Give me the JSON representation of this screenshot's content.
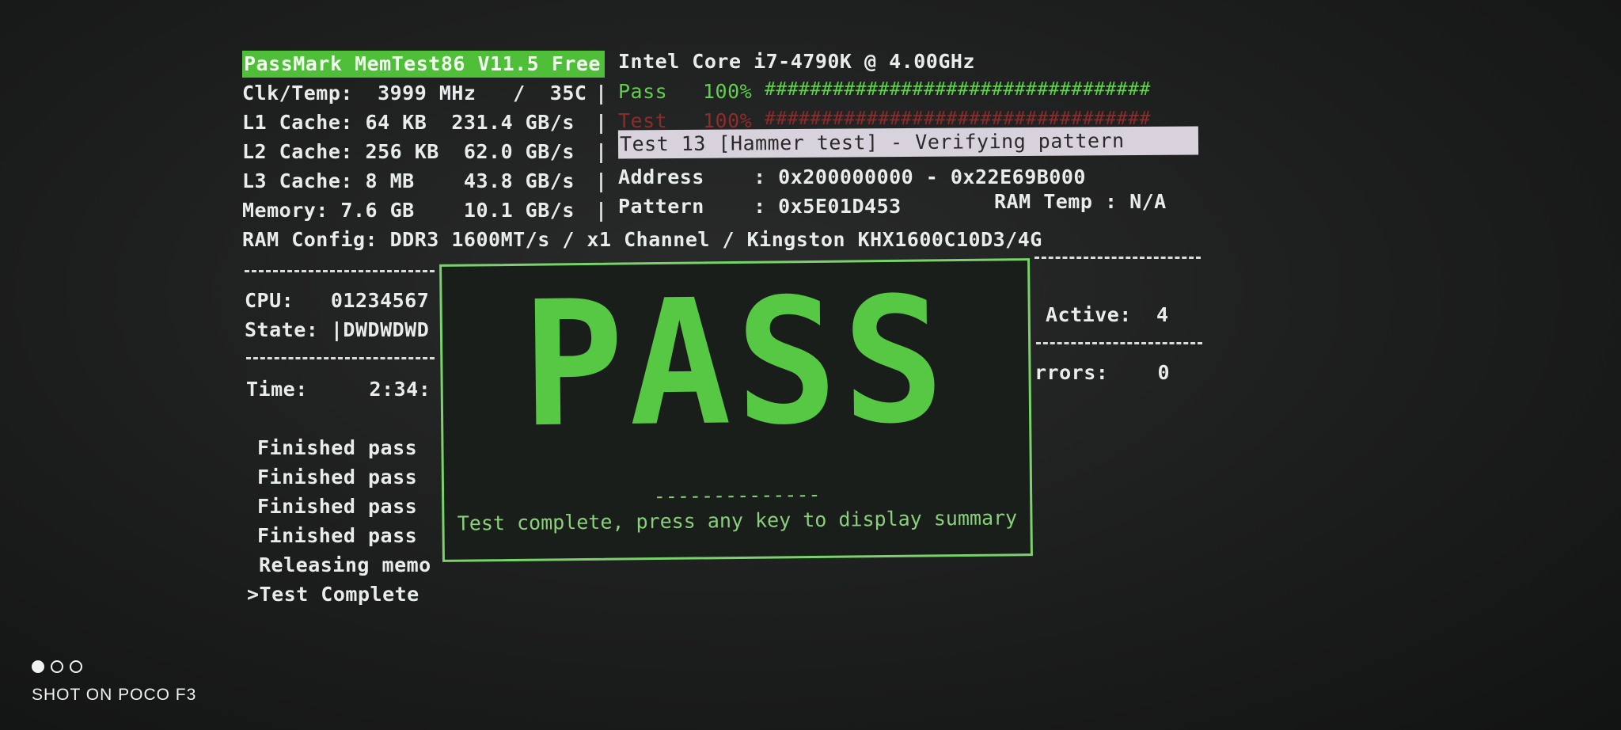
{
  "header": {
    "app_title": "PassMark MemTest86 V11.5 Free",
    "cpu_name": "Intel Core i7-4790K @ 4.00GHz"
  },
  "sysinfo": {
    "clk_temp": "Clk/Temp:  3999 MHz   /  35C",
    "l1": "L1 Cache: 64 KB  231.4 GB/s",
    "l2": "L2 Cache: 256 KB  62.0 GB/s",
    "l3": "L3 Cache: 8 MB    43.8 GB/s",
    "memory": "Memory: 7.6 GB    10.1 GB/s",
    "ram_config": "RAM Config: DDR3 1600MT/s / x1 Channel / Kingston KHX1600C10D3/4G"
  },
  "progress": {
    "pass_label": "Pass",
    "pass_pct": "100%",
    "pass_bar": "##################################",
    "pass_value": 1.0,
    "test_label": "Test",
    "test_pct": "100%",
    "test_bar": "##################################",
    "test_value": 1.0
  },
  "status": {
    "current_test": "Test 13 [Hammer test] - Verifying pattern",
    "address": "Address    : 0x200000000 - 0x22E69B000",
    "pattern": "Pattern    : 0x5E01D453",
    "ram_temp": "RAM Temp : N/A"
  },
  "cpu": {
    "cpu_line": "CPU:   01234567",
    "state_line": "State: |DWDWDWD",
    "active": "Active:  4"
  },
  "results": {
    "time": "Time:     2:34:",
    "errors": "rrors:    0"
  },
  "log": [
    "Finished pass",
    "Finished pass",
    "Finished pass",
    "Finished pass",
    "Releasing memo",
    ">Test Complete"
  ],
  "overlay": {
    "result": "PASS",
    "separator": "--------------",
    "message": "Test complete, press any key to display summary"
  },
  "watermark": {
    "text": "SHOT ON POCO F3"
  },
  "colors": {
    "accent_green": "#57c843",
    "title_green": "#4fbf3a",
    "fail_red": "#8f2b2b"
  }
}
